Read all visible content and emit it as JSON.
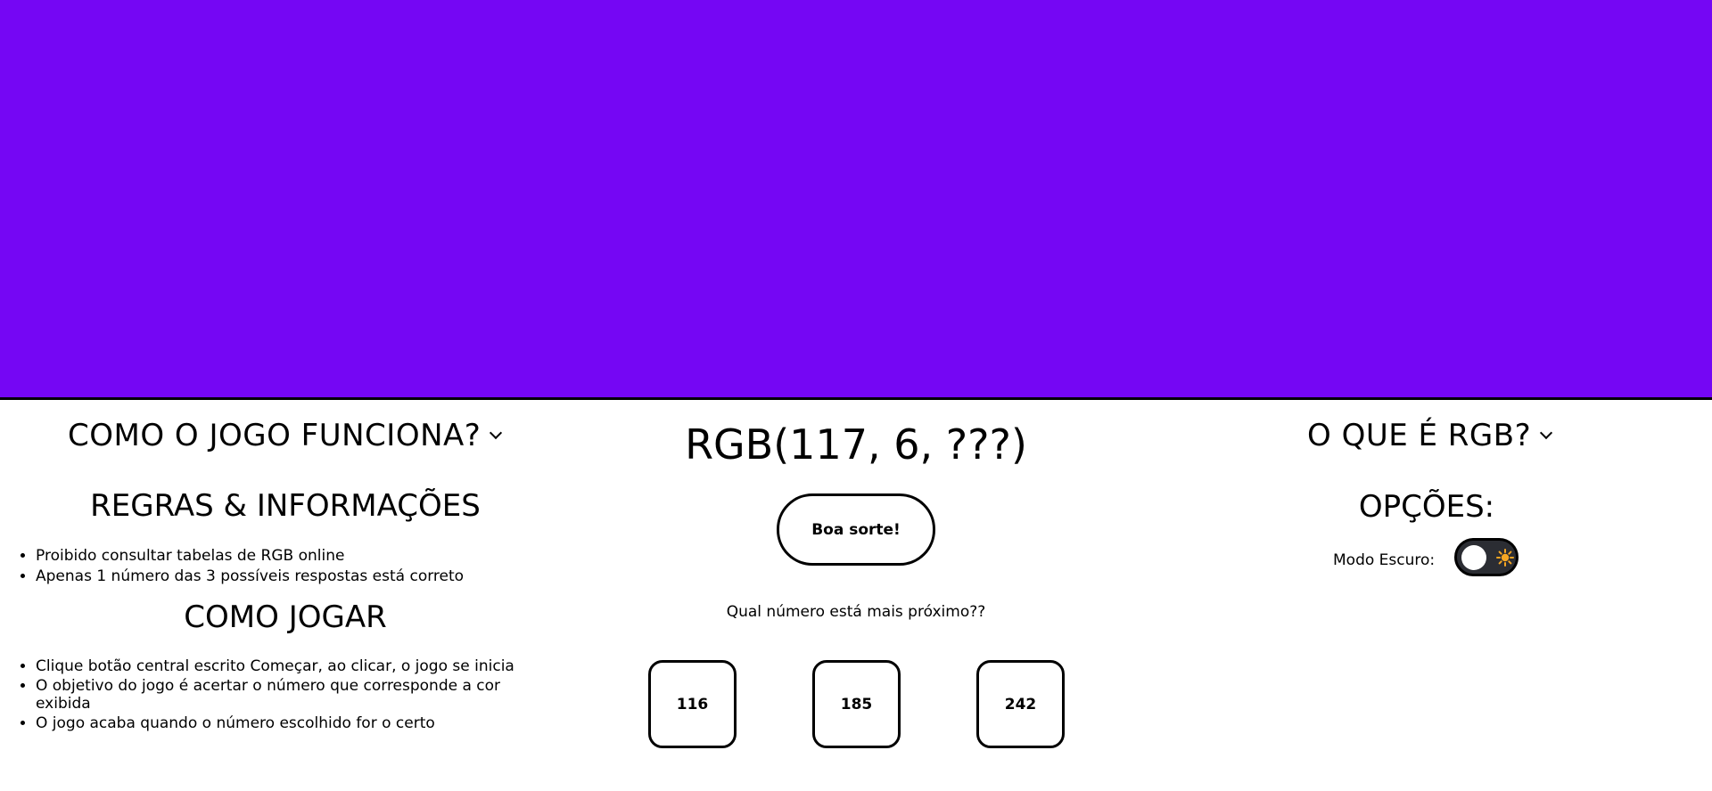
{
  "target_color": "#7506f4",
  "left": {
    "toggle_title": "COMO O JOGO FUNCIONA?",
    "rules_title": "REGRAS & INFORMAÇÕES",
    "rules": [
      "Proibido consultar tabelas de RGB online",
      "Apenas 1 número das 3 possíveis respostas está correto"
    ],
    "howto_title": "COMO JOGAR",
    "howto": [
      "Clique botão central escrito Começar, ao clicar, o jogo se inicia",
      "O objetivo do jogo é acertar o número que corresponde a cor exibida",
      "O jogo acaba quando o número escolhido for o certo"
    ]
  },
  "center": {
    "rgb_text": "RGB(117, 6, ???)",
    "start_label": "Boa sorte!",
    "question": "Qual número está mais próximo??",
    "answers": [
      "116",
      "185",
      "242"
    ]
  },
  "right": {
    "toggle_title": "O QUE É RGB?",
    "options_title": "OPÇÕES:",
    "dark_mode_label": "Modo Escuro:",
    "dark_mode_on": false,
    "icons": [
      "chevron-down-icon",
      "sun-icon"
    ]
  }
}
